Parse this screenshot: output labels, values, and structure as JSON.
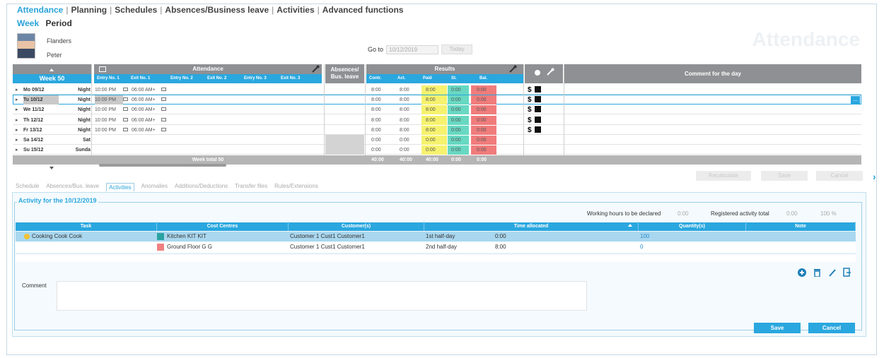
{
  "nav": {
    "tabs": [
      "Attendance",
      "Planning",
      "Schedules",
      "Absences/Business leave",
      "Activities",
      "Advanced functions"
    ],
    "subtabs": [
      "Week",
      "Period"
    ]
  },
  "watermark": "Attendance",
  "employee": {
    "last_name": "Flanders",
    "first_name": "Peter"
  },
  "goto": {
    "label": "Go to",
    "date": "10/12/2019",
    "today_button": "Today"
  },
  "week": {
    "label": "Week 50",
    "group_attendance": "Attendance",
    "group_absences": "Absences/ Bus. leave",
    "group_results": "Results",
    "comment_header": "Comment for the day",
    "attendance_cols": [
      "Entry No. 1",
      "Exit No. 1",
      "Entry No. 2",
      "Exit No. 2",
      "Entry No. 3",
      "Exit No. 3"
    ],
    "results_cols": [
      "Contr.",
      "Act.",
      "Paid",
      "St.",
      "Bal."
    ],
    "days": [
      {
        "day": "Mo 09/12",
        "shift": "Night",
        "entry": "10:00 PM",
        "exit": "06:00 AM+",
        "contr": "8:00",
        "act": "8:00",
        "paid": "8:00",
        "st": "0:00",
        "bal": "0:00",
        "money": "$"
      },
      {
        "day": "Tu 10/12",
        "shift": "Night",
        "entry": "10:00 PM",
        "exit": "06:00 AM+",
        "contr": "8:00",
        "act": "8:00",
        "paid": "8:00",
        "st": "0:00",
        "bal": "0:00",
        "money": "$"
      },
      {
        "day": "We 11/12",
        "shift": "Night",
        "entry": "10:00 PM",
        "exit": "06:00 AM+",
        "contr": "8:00",
        "act": "8:00",
        "paid": "8:00",
        "st": "0:00",
        "bal": "0:00",
        "money": "$"
      },
      {
        "day": "Th 12/12",
        "shift": "Night",
        "entry": "10:00 PM",
        "exit": "06:00 AM+",
        "contr": "8:00",
        "act": "8:00",
        "paid": "8:00",
        "st": "0:00",
        "bal": "0:00",
        "money": "$"
      },
      {
        "day": "Fr 13/12",
        "shift": "Night",
        "entry": "10:00 PM",
        "exit": "06:00 AM+",
        "contr": "8:00",
        "act": "8:00",
        "paid": "8:00",
        "st": "0:00",
        "bal": "0:00",
        "money": "$"
      },
      {
        "day": "Sa 14/12",
        "shift": "Sat",
        "entry": "",
        "exit": "",
        "contr": "0:00",
        "act": "0:00",
        "paid": "0:00",
        "st": "0:00",
        "bal": "0:00",
        "money": ""
      },
      {
        "day": "Su 15/12",
        "shift": "Sunda",
        "entry": "",
        "exit": "",
        "contr": "0:00",
        "act": "0:00",
        "paid": "0:00",
        "st": "0:00",
        "bal": "0:00",
        "money": ""
      }
    ],
    "totals": {
      "label": "Week total 50",
      "contr": "40:00",
      "act": "40:00",
      "paid": "40:00",
      "st": "0:00",
      "bal": "0:00"
    },
    "selected_index": 1
  },
  "week_actions": {
    "recalc": "Recalculate",
    "save": "Save",
    "cancel": "Cancel"
  },
  "detail_tabs": [
    "Schedule",
    "Absences/Bus. leave",
    "Activities",
    "Anomalies",
    "Additions/Deductions",
    "Transfer files",
    "Rules/Extensions"
  ],
  "detail_active": "Activities",
  "activity": {
    "title": "Activity for the 10/12/2019",
    "working_label": "Working hours to be declared",
    "working_value": "0:00",
    "registered_label": "Registered activity total",
    "registered_value": "0:00",
    "percent": "100 %",
    "headers": [
      "Task",
      "Cost Centres",
      "Customer(s)",
      "Time allocated",
      "Quantity(s)",
      "Note"
    ],
    "rows": [
      {
        "task": "Cooking Cook Cook",
        "cc": "Kitchen KIT KIT",
        "cc_color": "#2ba3a3",
        "customer": "Customer 1 Cust1 Customer1",
        "halfday": "1st half-day",
        "time": "0:00",
        "qty": "100",
        "note": ""
      },
      {
        "task": "",
        "cc": "Ground Floor G G",
        "cc_color": "#f08080",
        "customer": "Customer 1 Cust1 Customer1",
        "halfday": "2nd half-day",
        "time": "8:00",
        "qty": "0",
        "note": ""
      }
    ],
    "comment_label": "Comment",
    "save": "Save",
    "cancel": "Cancel"
  },
  "icons": [
    "add-icon",
    "delete-icon",
    "edit-icon",
    "export-icon",
    "wrench-icon",
    "calendar-icon",
    "money-icon",
    "chevron-right-icon"
  ]
}
